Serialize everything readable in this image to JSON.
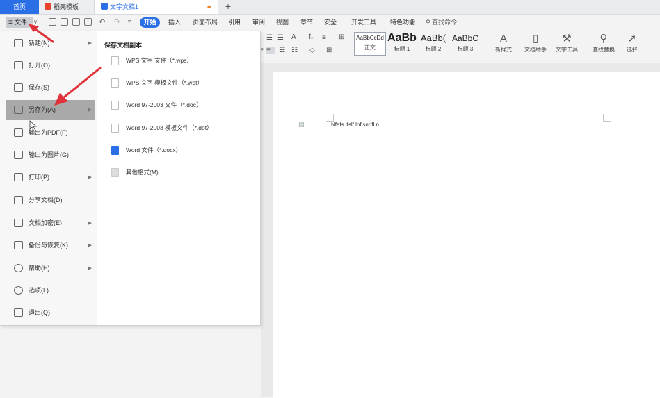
{
  "tabs": {
    "home": "首页",
    "template": "稻壳模板",
    "document": "文字文稿1",
    "new_tab": "+"
  },
  "menubar": {
    "file": "文件",
    "start": "开始",
    "items": [
      "插入",
      "页面布局",
      "引用",
      "审阅",
      "视图",
      "章节",
      "安全",
      "开发工具",
      "特色功能"
    ],
    "search_placeholder": "查找命令..."
  },
  "ribbon": {
    "styles": [
      {
        "sample": "AaBbCcDd",
        "label": "正文"
      },
      {
        "sample": "AaBb",
        "label": "标题 1"
      },
      {
        "sample": "AaBb(",
        "label": "标题 2"
      },
      {
        "sample": "AaBbC",
        "label": "标题 3"
      }
    ],
    "tools": [
      "新样式",
      "文档助手",
      "文字工具",
      "查找替换",
      "选择"
    ]
  },
  "file_menu": {
    "items": [
      {
        "label": "新建(N)",
        "arrow": true
      },
      {
        "label": "打开(O)",
        "arrow": false
      },
      {
        "label": "保存(S)",
        "arrow": false
      },
      {
        "label": "另存为(A)",
        "arrow": true,
        "highlighted": true
      },
      {
        "label": "输出为PDF(F)",
        "arrow": false
      },
      {
        "label": "输出为图片(G)",
        "arrow": false
      },
      {
        "label": "打印(P)",
        "arrow": true
      },
      {
        "label": "分享文档(D)",
        "arrow": false
      },
      {
        "label": "文档加密(E)",
        "arrow": true
      },
      {
        "label": "备份与恢复(K)",
        "arrow": true
      },
      {
        "label": "帮助(H)",
        "arrow": true
      },
      {
        "label": "选项(L)",
        "arrow": false
      },
      {
        "label": "退出(Q)",
        "arrow": false
      }
    ],
    "submenu_title": "保存文档副本",
    "submenu_items": [
      {
        "label": "WPS 文字 文件（*.wps）",
        "icon": "wps-file-icon"
      },
      {
        "label": "WPS 文字 模板文件（*.wpt）",
        "icon": "wpt-file-icon"
      },
      {
        "label": "Word 97-2003 文件（*.doc）",
        "icon": "doc-file-icon"
      },
      {
        "label": "Word 97-2003 模板文件（*.dot）",
        "icon": "dot-file-icon"
      },
      {
        "label": "Word 文件（*.docx）",
        "icon": "docx-file-icon"
      },
      {
        "label": "其他格式(M)",
        "icon": "other-format-icon"
      }
    ]
  },
  "document": {
    "text": "Nfafs lfslf lnflsndfl n"
  },
  "colors": {
    "accent": "#2b6fe6",
    "highlight": "#a9a9a9",
    "annotation_arrow": "#e0323a"
  }
}
